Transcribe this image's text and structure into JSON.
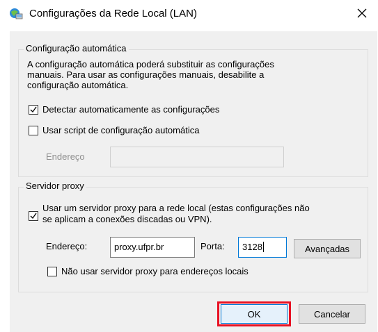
{
  "window": {
    "title": "Configurações da Rede Local (LAN)",
    "icon": "network-settings-icon",
    "close_glyph": "✕"
  },
  "auto_config": {
    "legend": "Configuração automática",
    "description_lines": [
      "A configuração automática poderá substituir as configurações",
      "manuais. Para usar as configurações manuais, desabilite a",
      "configuração automática."
    ],
    "detect_label": "Detectar automaticamente as configurações",
    "detect_checked": true,
    "script_label": "Usar script de configuração automática",
    "script_checked": false,
    "address_label": "Endereço",
    "address_value": ""
  },
  "proxy": {
    "legend": "Servidor proxy",
    "use_proxy_line1": "Usar um servidor proxy para a rede local (estas configurações não",
    "use_proxy_line2": "se aplicam a conexões discadas ou VPN).",
    "use_proxy_checked": true,
    "address_label": "Endereço:",
    "address_value": "proxy.ufpr.br",
    "port_label": "Porta:",
    "port_value": "3128",
    "advanced_label": "Avançadas",
    "bypass_label": "Não usar servidor proxy para endereços locais",
    "bypass_checked": false
  },
  "buttons": {
    "ok_label": "OK",
    "cancel_label": "Cancelar"
  },
  "colors": {
    "highlight": "#e81123",
    "focus": "#0078d7",
    "dialog_bg": "#f0f0f0"
  }
}
